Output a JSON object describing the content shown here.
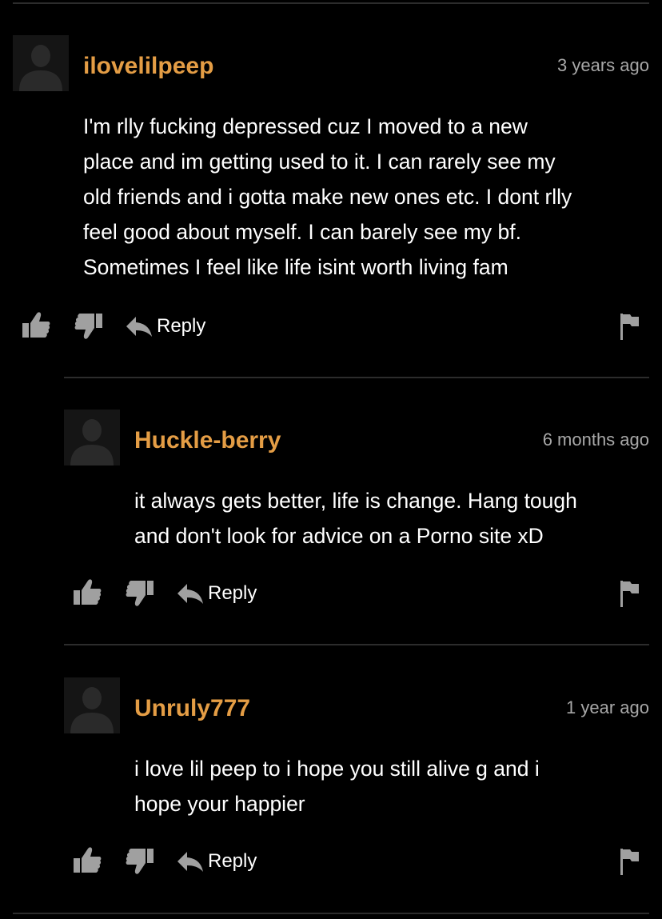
{
  "comments": [
    {
      "username": "ilovelilpeep",
      "time": "3 years ago",
      "lines": [
        "I'm rlly fucking depressed cuz I moved to a new",
        "place and im getting used to it. I can rarely see my",
        "old friends and i gotta make new ones etc. I dont rlly",
        "feel good about myself. I can barely see my bf.",
        "Sometimes I feel like life isint worth living fam"
      ],
      "reply_label": "Reply"
    },
    {
      "username": "Huckle-berry",
      "time": "6 months ago",
      "lines": [
        "it always gets better, life is change. Hang tough",
        "and don't look for advice on a Porno site xD"
      ],
      "reply_label": "Reply"
    },
    {
      "username": "Unruly777",
      "time": "1 year ago",
      "lines": [
        "i love lil peep to i hope you still alive g and i",
        "hope your happier"
      ],
      "reply_label": "Reply"
    }
  ],
  "colors": {
    "background": "#000000",
    "username": "#e49d45",
    "timestamp": "#a8a8a8",
    "icon": "#a0a0a0",
    "divider": "#2c2c2c"
  },
  "icons": [
    "avatar-silhouette",
    "thumbs-up-icon",
    "thumbs-down-icon",
    "reply-arrow-icon",
    "flag-icon"
  ]
}
